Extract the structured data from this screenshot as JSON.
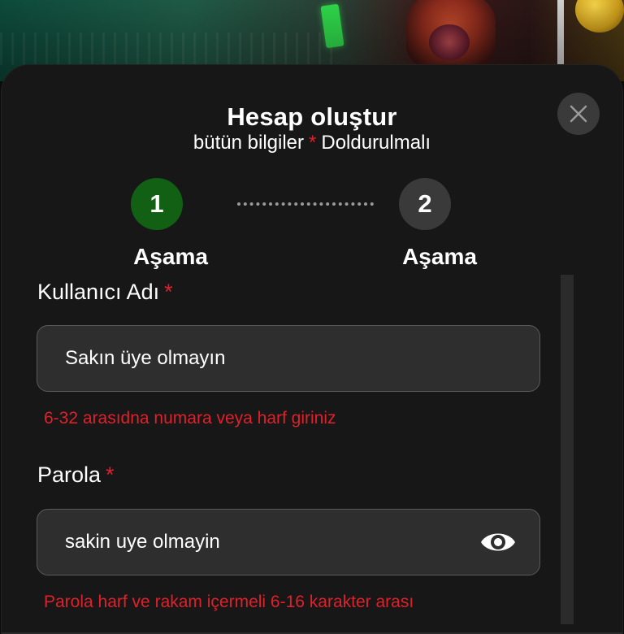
{
  "modal": {
    "title": "Hesap oluştur",
    "subtitle_before": "bütün bilgiler",
    "subtitle_star": "*",
    "subtitle_after": "Doldurulmalı"
  },
  "steps": [
    {
      "number": "1",
      "label": "Aşama",
      "state": "active",
      "color": "#116014"
    },
    {
      "number": "2",
      "label": "Aşama",
      "state": "inactive",
      "color": "#3a3a3a"
    }
  ],
  "fields": {
    "username": {
      "label": "Kullanıcı Adı",
      "required_mark": "*",
      "value": "Sakın üye olmayın",
      "error": "6-32 arasıdna numara veya harf giriniz"
    },
    "password": {
      "label": "Parola",
      "required_mark": "*",
      "value": "sakin uye olmayin",
      "error": "Parola harf ve rakam içermeli 6-16 karakter arası"
    }
  },
  "icons": {
    "close": "close-icon",
    "visibility": "eye-icon"
  },
  "colors": {
    "accent_green": "#116014",
    "error_red": "#e0202a",
    "modal_bg": "#171717",
    "input_bg": "#2e2e2e"
  }
}
